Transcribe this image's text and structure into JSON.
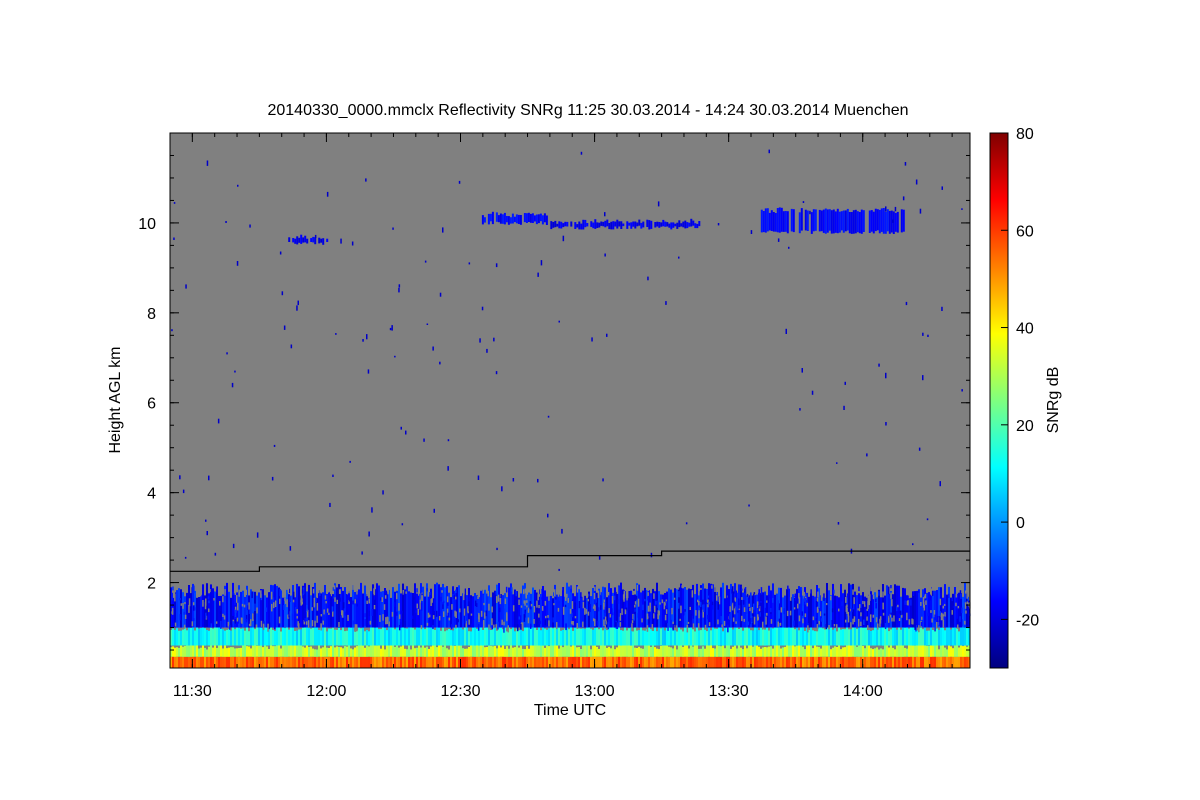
{
  "chart_data": {
    "type": "heatmap",
    "title": "20140330_0000.mmclx Reflectivity SNRg   11:25 30.03.2014 - 14:24 30.03.2014 Muenchen",
    "xlabel": "Time UTC",
    "ylabel": "Height AGL km",
    "colorbar_label": "SNRg dB",
    "xlim_hours": [
      11.4167,
      14.4
    ],
    "ylim_km": [
      0.1,
      12.0
    ],
    "x_ticks": [
      {
        "value": 11.5,
        "label": "11:30"
      },
      {
        "value": 12.0,
        "label": "12:00"
      },
      {
        "value": 12.5,
        "label": "12:30"
      },
      {
        "value": 13.0,
        "label": "13:00"
      },
      {
        "value": 13.5,
        "label": "13:30"
      },
      {
        "value": 14.0,
        "label": "14:00"
      }
    ],
    "y_ticks": [
      {
        "value": 2,
        "label": "2"
      },
      {
        "value": 4,
        "label": "4"
      },
      {
        "value": 6,
        "label": "6"
      },
      {
        "value": 8,
        "label": "8"
      },
      {
        "value": 10,
        "label": "10"
      }
    ],
    "colorbar_range": [
      -30,
      80
    ],
    "colorbar_ticks": [
      {
        "value": -20,
        "label": "-20"
      },
      {
        "value": 0,
        "label": "0"
      },
      {
        "value": 20,
        "label": "20"
      },
      {
        "value": 40,
        "label": "40"
      },
      {
        "value": 60,
        "label": "60"
      },
      {
        "value": 80,
        "label": "80"
      }
    ],
    "colormap": "jet",
    "no_signal_color": "#808080",
    "colormap_stops": [
      "#00007f",
      "#0000ff",
      "#007fff",
      "#00ffff",
      "#7fff7f",
      "#ffff00",
      "#ff7f00",
      "#ff0000",
      "#7f0000"
    ],
    "boundary_layer_line": [
      {
        "t": 11.4167,
        "h": 2.25
      },
      {
        "t": 11.75,
        "h": 2.25
      },
      {
        "t": 11.75,
        "h": 2.35
      },
      {
        "t": 12.75,
        "h": 2.35
      },
      {
        "t": 12.75,
        "h": 2.6
      },
      {
        "t": 13.25,
        "h": 2.6
      },
      {
        "t": 13.25,
        "h": 2.7
      },
      {
        "t": 14.4,
        "h": 2.7
      }
    ],
    "echo_regions": [
      {
        "name": "surface",
        "t_start": 11.4167,
        "t_end": 14.4,
        "h_low": 0.1,
        "h_high": 0.35,
        "snr_db": 55
      },
      {
        "name": "surface",
        "t_start": 11.4167,
        "t_end": 14.4,
        "h_low": 0.35,
        "h_high": 0.6,
        "snr_db": 32
      },
      {
        "name": "surface",
        "t_start": 11.4167,
        "t_end": 14.4,
        "h_low": 0.6,
        "h_high": 1.0,
        "snr_db": 12
      },
      {
        "name": "boundary layer",
        "t_start": 11.4167,
        "t_end": 14.4,
        "h_low": 1.0,
        "h_high": 2.0,
        "snr_db": -15
      },
      {
        "name": "cirrus",
        "t_start": 11.85,
        "t_end": 12.0,
        "h_low": 9.5,
        "h_high": 9.75,
        "snr_db": -18
      },
      {
        "name": "cirrus",
        "t_start": 12.58,
        "t_end": 12.82,
        "h_low": 9.95,
        "h_high": 10.25,
        "snr_db": -16
      },
      {
        "name": "cirrus",
        "t_start": 12.82,
        "t_end": 13.4,
        "h_low": 9.85,
        "h_high": 10.1,
        "snr_db": -18
      },
      {
        "name": "cirrus",
        "t_start": 13.62,
        "t_end": 14.15,
        "h_low": 9.75,
        "h_high": 10.35,
        "snr_db": -16
      }
    ]
  }
}
